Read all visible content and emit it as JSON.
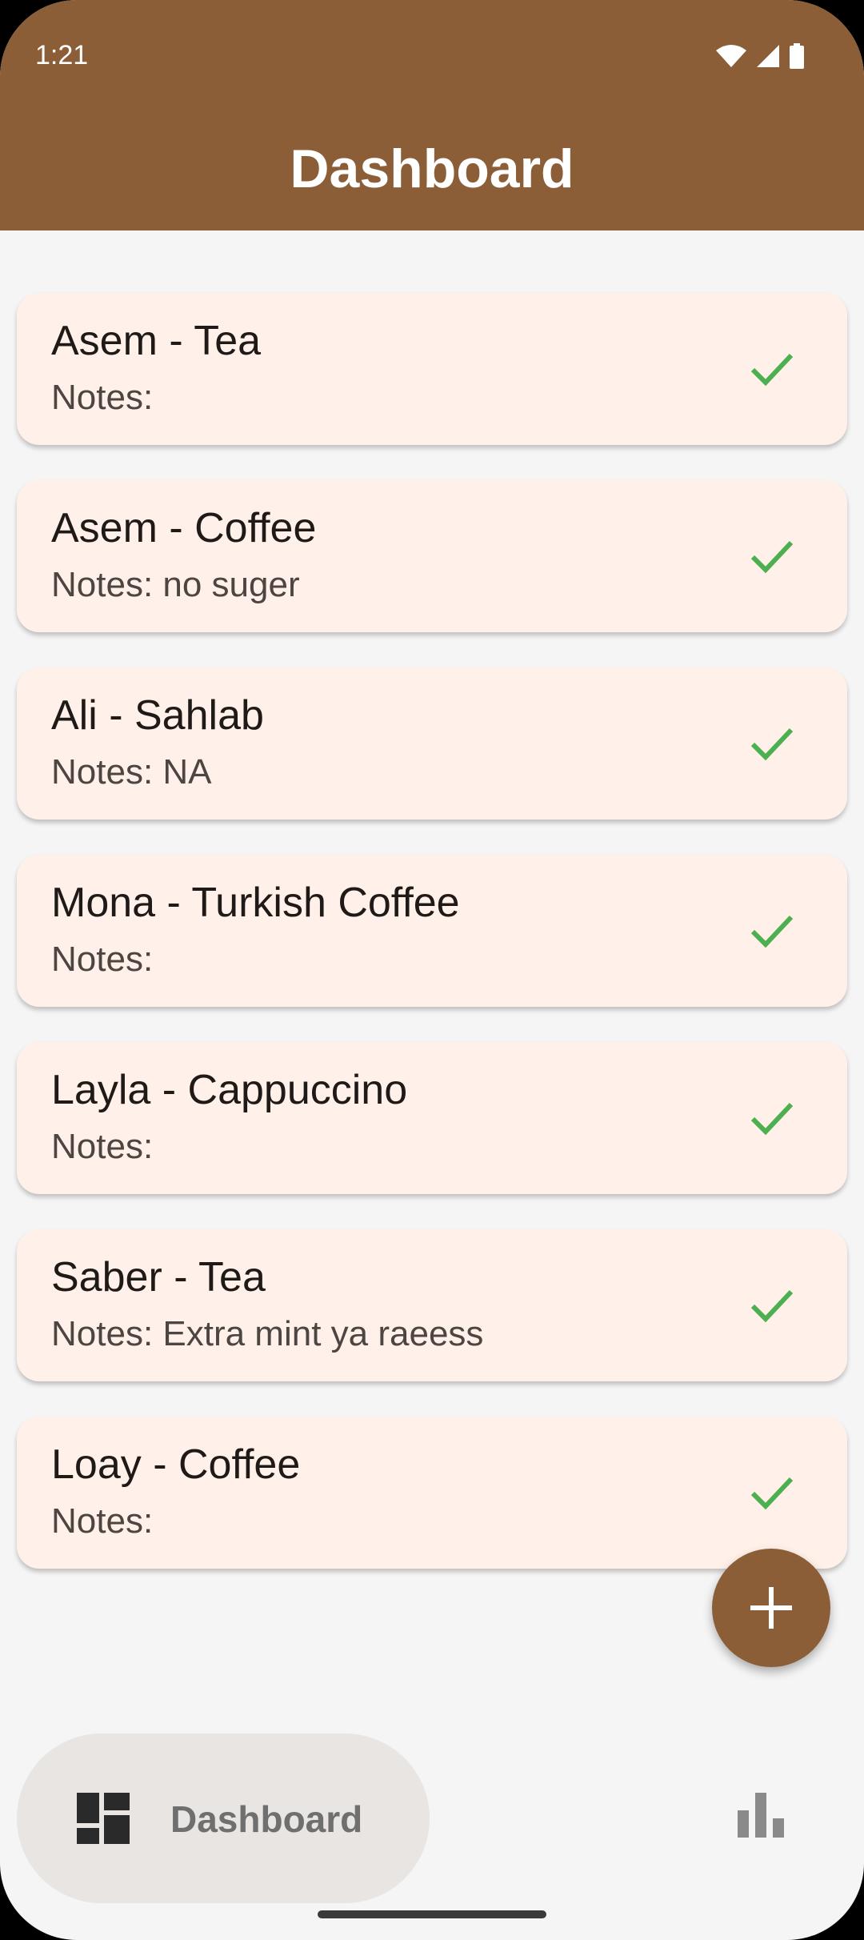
{
  "status_bar": {
    "time": "1:21",
    "icons": [
      "wifi-icon",
      "signal-icon",
      "battery-icon"
    ]
  },
  "app_bar": {
    "title": "Dashboard"
  },
  "orders": [
    {
      "title": "Asem - Tea",
      "notes": "Notes: ",
      "status_icon": "check-icon"
    },
    {
      "title": "Asem - Coffee",
      "notes": "Notes: no suger",
      "status_icon": "check-icon"
    },
    {
      "title": "Ali - Sahlab",
      "notes": "Notes: NA",
      "status_icon": "check-icon"
    },
    {
      "title": "Mona - Turkish Coffee",
      "notes": "Notes: ",
      "status_icon": "check-icon"
    },
    {
      "title": "Layla - Cappuccino",
      "notes": "Notes: ",
      "status_icon": "check-icon"
    },
    {
      "title": "Saber - Tea",
      "notes": "Notes: Extra mint ya raeess",
      "status_icon": "check-icon"
    },
    {
      "title": "Loay - Coffee",
      "notes": "Notes: ",
      "status_icon": "check-icon"
    }
  ],
  "fab": {
    "icon": "plus-icon"
  },
  "bottom_nav": {
    "items": [
      {
        "label": "Dashboard",
        "icon": "dashboard-icon",
        "selected": true
      },
      {
        "label": "",
        "icon": "bar-chart-icon",
        "selected": false
      }
    ]
  },
  "colors": {
    "primary": "#8b5e37",
    "card_background": "#fff1e9",
    "check": "#4caf50",
    "nav_selected_background": "#e8e5e2"
  }
}
